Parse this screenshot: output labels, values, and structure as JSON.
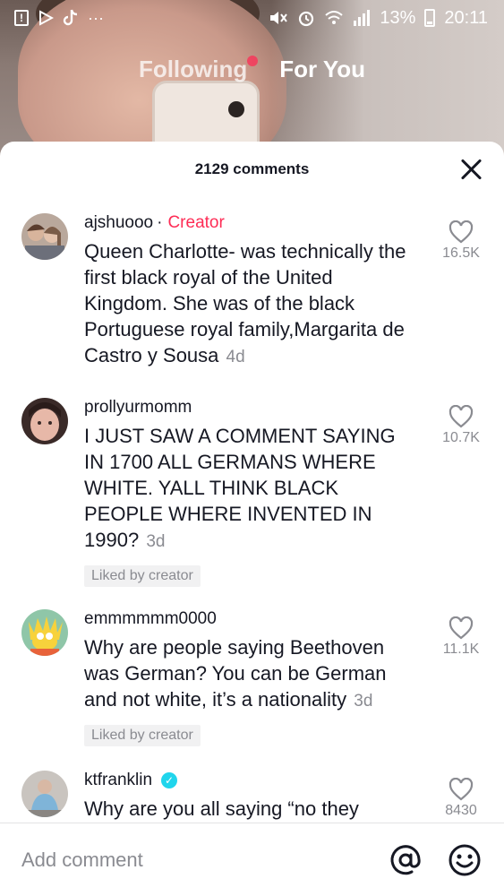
{
  "status_bar": {
    "notif_icon_1": "!",
    "battery_percent": "13%",
    "time": "20:11"
  },
  "feed_tabs": {
    "following": "Following",
    "for_you": "For You"
  },
  "comments_sheet": {
    "title": "2129 comments",
    "comments": [
      {
        "username": "ajshuooo",
        "separator": "·",
        "creator_tag": "Creator",
        "text": "Queen Charlotte- was technically the first black royal of the United Kingdom. She was of the black Portuguese royal family,Margarita de Castro y Sousa",
        "time": "4d",
        "likes": "16.5K"
      },
      {
        "username": "prollyurmomm",
        "text": "I JUST SAW A COMMENT SAYING IN 1700 ALL GERMANS WHERE WHITE. YALL THINK BLACK PEOPLE WHERE INVENTED IN 1990?",
        "time": "3d",
        "badge": "Liked by creator",
        "likes": "10.7K"
      },
      {
        "username": "emmmmmm0000",
        "text": "Why are people saying Beethoven was German? You can be German and not white, it’s a nationality",
        "time": "3d",
        "badge": "Liked by creator",
        "likes": "11.1K"
      },
      {
        "username": "ktfranklin",
        "verified_icon": "verified-check-icon",
        "text": "Why are you all saying “no they",
        "likes": "8430"
      }
    ]
  },
  "footer": {
    "placeholder": "Add comment",
    "mention_icon": "@"
  },
  "colors": {
    "accent": "#fe2c55",
    "verified": "#20d5ec",
    "muted": "#8a8b91"
  }
}
